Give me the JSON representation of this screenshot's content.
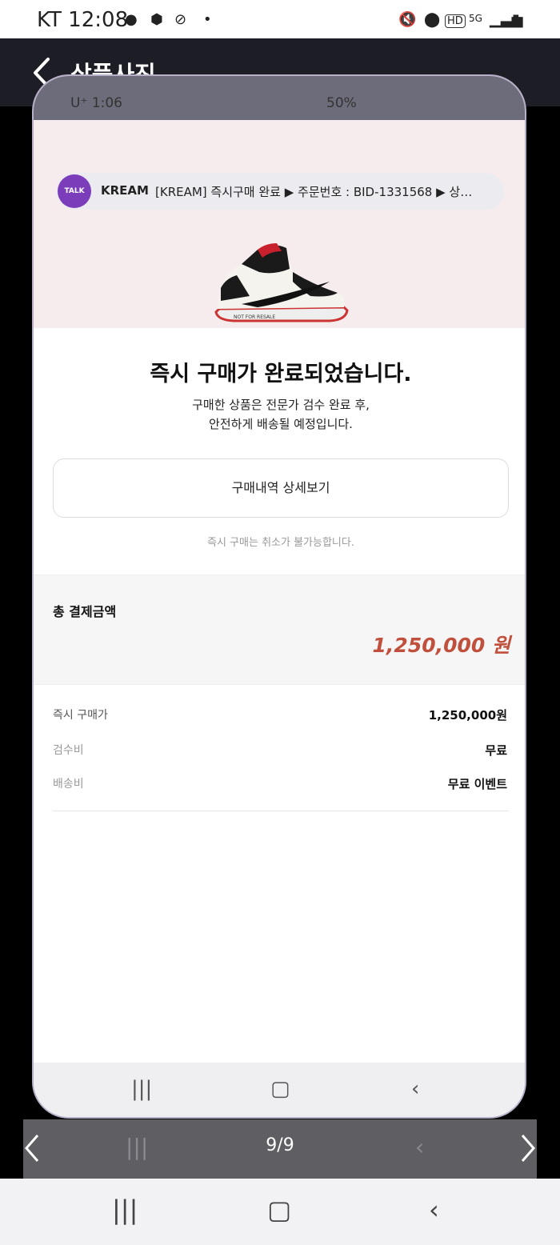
{
  "outer_status": {
    "carrier_time": "KT 12:08",
    "dot": "•"
  },
  "header": {
    "title": "상품사진"
  },
  "inner_status": {
    "left_text": "U⁺ 1:06",
    "right_text": "50%"
  },
  "notification": {
    "app_badge": "TALK",
    "app_name": "KREAM",
    "text": "[KREAM] 즉시구매 완료 ▶ 주문번호 : BID-1331568 ▶ 상…"
  },
  "product_image": {
    "shoe_label": "NOT FOR RESALE"
  },
  "confirmation": {
    "title": "즉시 구매가 완료되었습니다.",
    "subtitle_line1": "구매한 상품은 전문가 검수 완료 후,",
    "subtitle_line2": "안전하게 배송될 예정입니다.",
    "detail_button": "구매내역 상세보기",
    "cancel_note": "즉시 구매는 취소가 불가능합니다."
  },
  "total": {
    "label": "총 결제금액",
    "value": "1,250,000 원"
  },
  "rows": [
    {
      "label": "즉시 구매가",
      "value": "1,250,000원"
    },
    {
      "label": "검수비",
      "value": "무료"
    },
    {
      "label": "배송비",
      "value": "무료 이벤트"
    }
  ],
  "gallery": {
    "counter": "9/9"
  },
  "colors": {
    "header_bg": "#1d1d26",
    "total_accent": "#c0503c",
    "talk_badge": "#7c3dbb"
  }
}
